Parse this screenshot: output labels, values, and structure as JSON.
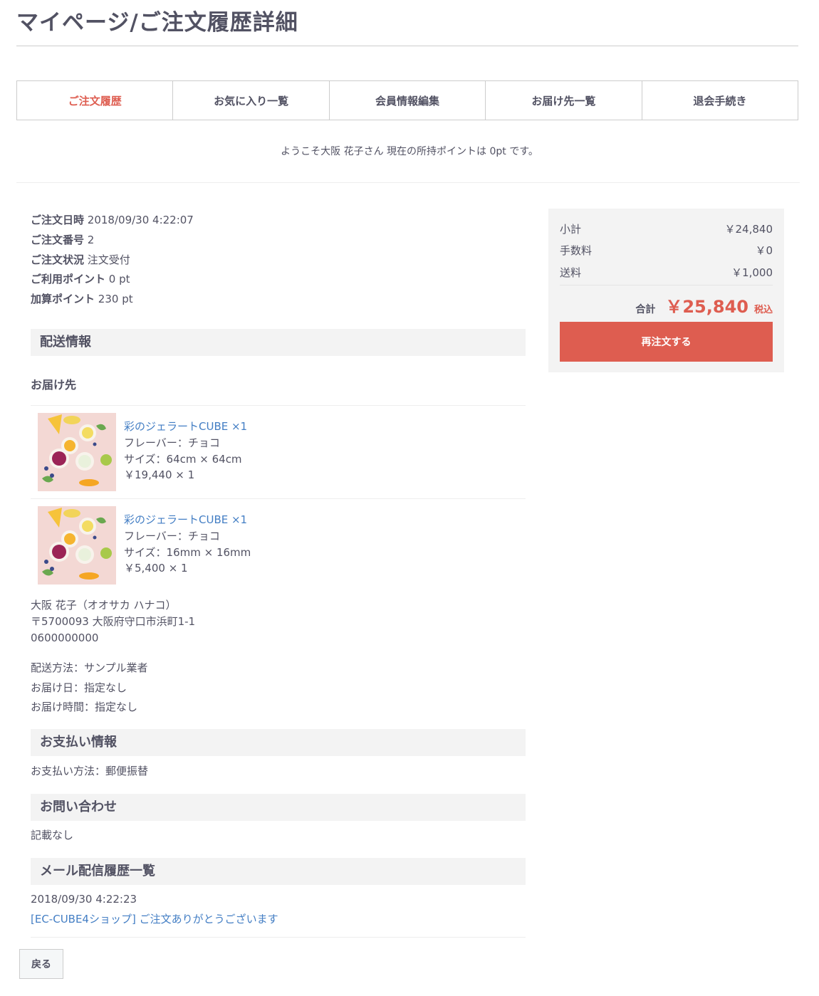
{
  "page": {
    "title": "マイページ/ご注文履歴詳細"
  },
  "nav": [
    {
      "label": "ご注文履歴",
      "active": true
    },
    {
      "label": "お気に入り一覧"
    },
    {
      "label": "会員情報編集"
    },
    {
      "label": "お届け先一覧"
    },
    {
      "label": "退会手続き"
    }
  ],
  "welcome": "ようこそ大阪 花子さん 現在の所持ポイントは 0pt です。",
  "order": {
    "date_label": "ご注文日時",
    "date": "2018/09/30 4:22:07",
    "number_label": "ご注文番号",
    "number": "2",
    "status_label": "ご注文状況",
    "status": "注文受付",
    "used_points_label": "ご利用ポイント",
    "used_points": "0 pt",
    "added_points_label": "加算ポイント",
    "added_points": "230 pt"
  },
  "shipping": {
    "heading": "配送情報",
    "dest_label": "お届け先",
    "items": [
      {
        "name": "彩のジェラートCUBE ×1",
        "flavor": "フレーバー：チョコ",
        "size": "サイズ：64cm × 64cm",
        "price": "￥19,440 × 1"
      },
      {
        "name": "彩のジェラートCUBE ×1",
        "flavor": "フレーバー：チョコ",
        "size": "サイズ：16mm × 16mm",
        "price": "￥5,400 × 1"
      }
    ],
    "recipient": "大阪 花子（オオサカ ハナコ）",
    "address": "〒5700093 大阪府守口市浜町1-1",
    "phone": "0600000000",
    "method": "配送方法：サンプル業者",
    "date": "お届け日：指定なし",
    "time": "お届け時間：指定なし"
  },
  "payment": {
    "heading": "お支払い情報",
    "method": "お支払い方法：郵便振替"
  },
  "inquiry": {
    "heading": "お問い合わせ",
    "text": "記載なし"
  },
  "mail": {
    "heading": "メール配信履歴一覧",
    "date": "2018/09/30 4:22:23",
    "subject": "[EC-CUBE4ショップ] ご注文ありがとうございます"
  },
  "summary": {
    "subtotal_label": "小計",
    "subtotal": "￥24,840",
    "fee_label": "手数料",
    "fee": "￥0",
    "shipping_label": "送料",
    "shipping": "￥1,000",
    "total_label": "合計",
    "total": "￥25,840",
    "tax_label": "税込",
    "reorder_label": "再注文する"
  },
  "back_label": "戻る",
  "colors": {
    "accent": "#de5d50",
    "link": "#437ec4",
    "text": "#525263",
    "section_bg": "#f3f3f3"
  }
}
